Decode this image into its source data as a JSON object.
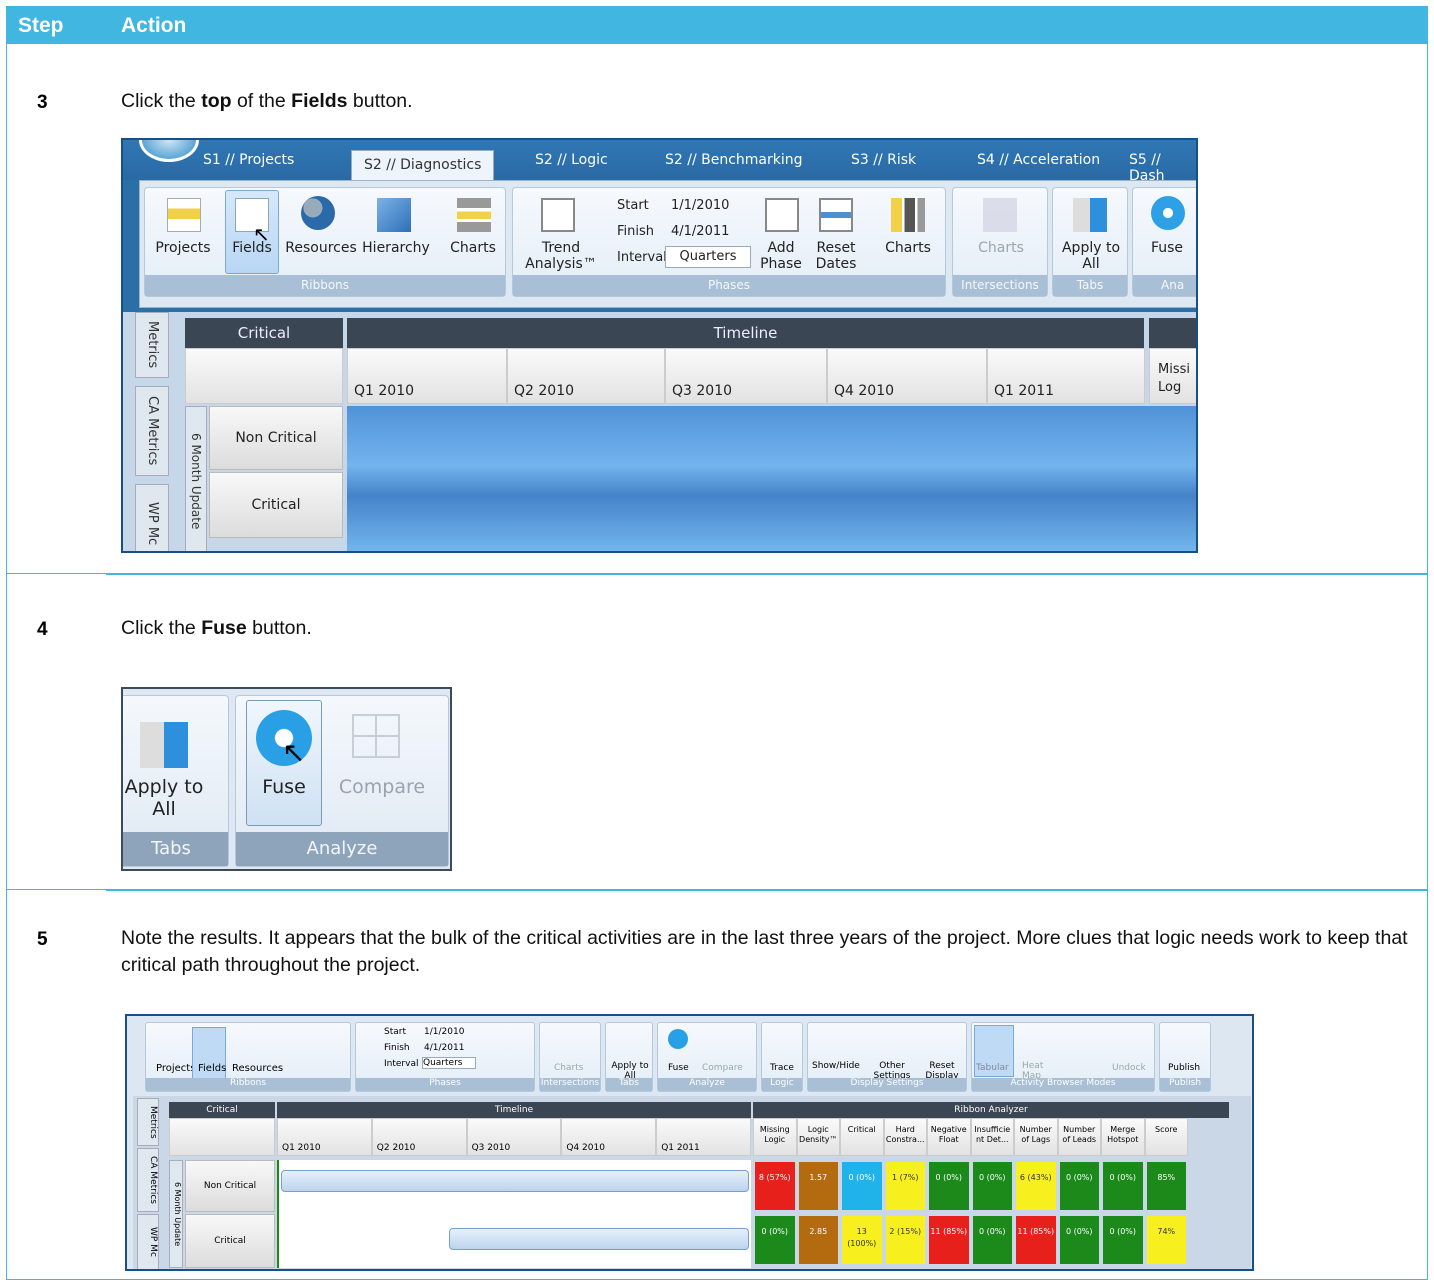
{
  "header": {
    "step": "Step",
    "action": "Action"
  },
  "steps": [
    {
      "num": "3",
      "text_pre": "Click the ",
      "b1": "top",
      "text_mid": " of the ",
      "b2": "Fields",
      "text_post": " button."
    },
    {
      "num": "4",
      "text_pre": "Click the ",
      "b1": "Fuse",
      "text_post": " button."
    },
    {
      "num": "5",
      "text": "Note the results. It appears that the bulk of the critical activities are in the last three years of the project. More clues that logic needs work to keep that critical path throughout the project."
    }
  ],
  "s1": {
    "tabs": [
      "S1 // Projects",
      "S2 // Diagnostics",
      "S2 // Logic",
      "S2 // Benchmarking",
      "S3 // Risk",
      "S4 // Acceleration",
      "S5 // Dash"
    ],
    "buttons": {
      "projects": "Projects",
      "fields": "Fields",
      "resources": "Resources",
      "hierarchy": "Hierarchy",
      "charts": "Charts",
      "trend": "Trend Analysis™",
      "add_phase": "Add Phase",
      "reset_dates": "Reset Dates",
      "charts2": "Charts",
      "charts3": "Charts",
      "apply_all": "Apply to All",
      "fuse": "Fuse"
    },
    "phases": {
      "start_label": "Start",
      "start": "1/1/2010",
      "finish_label": "Finish",
      "finish": "4/1/2011",
      "interval_label": "Interval",
      "interval": "Quarters"
    },
    "groups": {
      "ribbons": "Ribbons",
      "phases": "Phases",
      "intersections": "Intersections",
      "tabs": "Tabs",
      "ana": "Ana"
    },
    "side_tabs": [
      "Metrics",
      "CA Metrics",
      "WP Mc"
    ],
    "six_month": "6 Month Update",
    "grid": {
      "critical": "Critical",
      "timeline": "Timeline",
      "missing": "Missi Log",
      "quarters": [
        "Q1 2010",
        "Q2 2010",
        "Q3 2010",
        "Q4 2010",
        "Q1 2011"
      ],
      "rows": [
        "Non Critical",
        "Critical"
      ]
    }
  },
  "s2": {
    "apply": "Apply to All",
    "fuse": "Fuse",
    "compare": "Compare",
    "tabs": "Tabs",
    "analyze": "Analyze"
  },
  "s3": {
    "buttons": {
      "projects": "Projects",
      "fields": "Fields",
      "resources": "Resources",
      "charts": "Charts",
      "apply": "Apply to All",
      "fuse": "Fuse",
      "compare": "Compare",
      "trace": "Trace",
      "showhide": "Show/Hide",
      "other": "Other Settings",
      "reset": "Reset Display",
      "tabular": "Tabular",
      "heat": "Heat Map",
      "undock": "Undock",
      "publish": "Publish"
    },
    "phases": {
      "start_label": "Start",
      "start": "1/1/2010",
      "finish_label": "Finish",
      "finish": "4/1/2011",
      "interval_label": "Interval",
      "interval": "Quarters"
    },
    "groups": [
      "Ribbons",
      "Phases",
      "Intersections",
      "Tabs",
      "Analyze",
      "Logic",
      "Display Settings",
      "Activity Browser Modes",
      "Publish"
    ],
    "side_tabs": [
      "Metrics",
      "CA Metrics",
      "WP Mc"
    ],
    "six_month": "6 Month Update",
    "grid": {
      "critical": "Critical",
      "timeline": "Timeline",
      "analyzer": "Ribbon Analyzer",
      "quarters": [
        "Q1 2010",
        "Q2 2010",
        "Q3 2010",
        "Q4 2010",
        "Q1 2011"
      ],
      "rows": [
        "Non Critical",
        "Critical"
      ],
      "cols": [
        "Missing Logic",
        "Logic Density™",
        "Critical",
        "Hard Constra...",
        "Negative Float",
        "Insufficie nt Det...",
        "Number of Lags",
        "Number of Leads",
        "Merge Hotspot",
        "Score"
      ],
      "row1": [
        "8 (57%)",
        "1.57",
        "0 (0%)",
        "1 (7%)",
        "0 (0%)",
        "0 (0%)",
        "6 (43%)",
        "0 (0%)",
        "0 (0%)",
        "85%"
      ],
      "row2": [
        "0 (0%)",
        "2.85",
        "13 (100%)",
        "2 (15%)",
        "11 (85%)",
        "0 (0%)",
        "11 (85%)",
        "0 (0%)",
        "0 (0%)",
        "74%"
      ]
    }
  },
  "colors": {
    "header": "#40b6e0",
    "red": "#e8201b",
    "green": "#1b8a1b",
    "yellow": "#f7f01e",
    "blue": "#1fb3ea",
    "brown": "#b46b0f"
  }
}
